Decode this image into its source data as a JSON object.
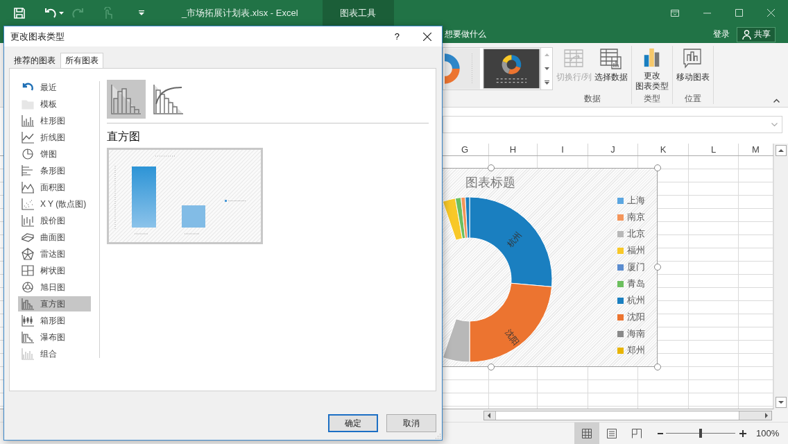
{
  "excel": {
    "title": "_市场拓展计划表.xlsx - Excel",
    "context_tab": "图表工具",
    "tell_me": "想要做什么",
    "sign_in": "登录",
    "share": "共享",
    "ribbon_groups": [
      {
        "label": "数据",
        "buttons": [
          {
            "lines": [
              "切换行/列"
            ],
            "disabled": true
          },
          {
            "lines": [
              "选择数据"
            ],
            "disabled": false
          }
        ]
      },
      {
        "label": "类型",
        "buttons": [
          {
            "lines": [
              "更改",
              "图表类型"
            ],
            "disabled": false
          }
        ]
      },
      {
        "label": "位置",
        "buttons": [
          {
            "lines": [
              "移动图表"
            ],
            "disabled": false
          }
        ]
      }
    ],
    "columns": [
      "G",
      "H",
      "I",
      "J",
      "K",
      "L",
      "M"
    ],
    "chart": {
      "title": "图表标题",
      "slice_labels": [
        "杭州",
        "沈阳"
      ],
      "legend": [
        {
          "label": "上海",
          "color": "#5ba6e0"
        },
        {
          "label": "南京",
          "color": "#f4955a"
        },
        {
          "label": "北京",
          "color": "#b8b8b8"
        },
        {
          "label": "福州",
          "color": "#f8c828"
        },
        {
          "label": "厦门",
          "color": "#5b8ccf"
        },
        {
          "label": "青岛",
          "color": "#6cbf5e"
        },
        {
          "label": "杭州",
          "color": "#1a7fc0"
        },
        {
          "label": "沈阳",
          "color": "#ec7430"
        },
        {
          "label": "海南",
          "color": "#8a8a8a"
        },
        {
          "label": "郑州",
          "color": "#e8b400"
        }
      ]
    },
    "views": [
      {
        "selected": true
      },
      {
        "selected": false
      },
      {
        "selected": false
      }
    ],
    "zoom": {
      "level": 0.5,
      "value": "100%"
    }
  },
  "dialog": {
    "title": "更改图表类型",
    "help": "?",
    "tabs": [
      {
        "label": "推荐的图表",
        "selected": false
      },
      {
        "label": "所有图表",
        "selected": true
      }
    ],
    "types": [
      {
        "label": "最近",
        "selected": false
      },
      {
        "label": "模板",
        "selected": false
      },
      {
        "label": "柱形图",
        "selected": false
      },
      {
        "label": "折线图",
        "selected": false
      },
      {
        "label": "饼图",
        "selected": false
      },
      {
        "label": "条形图",
        "selected": false
      },
      {
        "label": "面积图",
        "selected": false
      },
      {
        "label": "X Y (散点图)",
        "selected": false
      },
      {
        "label": "股价图",
        "selected": false
      },
      {
        "label": "曲面图",
        "selected": false
      },
      {
        "label": "雷达图",
        "selected": false
      },
      {
        "label": "树状图",
        "selected": false
      },
      {
        "label": "旭日图",
        "selected": false
      },
      {
        "label": "直方图",
        "selected": true
      },
      {
        "label": "箱形图",
        "selected": false
      },
      {
        "label": "瀑布图",
        "selected": false
      },
      {
        "label": "组合",
        "selected": false
      }
    ],
    "subtypes": [
      {
        "selected": true
      },
      {
        "selected": false
      }
    ],
    "heading": "直方图",
    "buttons": [
      "确定",
      "取消"
    ]
  }
}
